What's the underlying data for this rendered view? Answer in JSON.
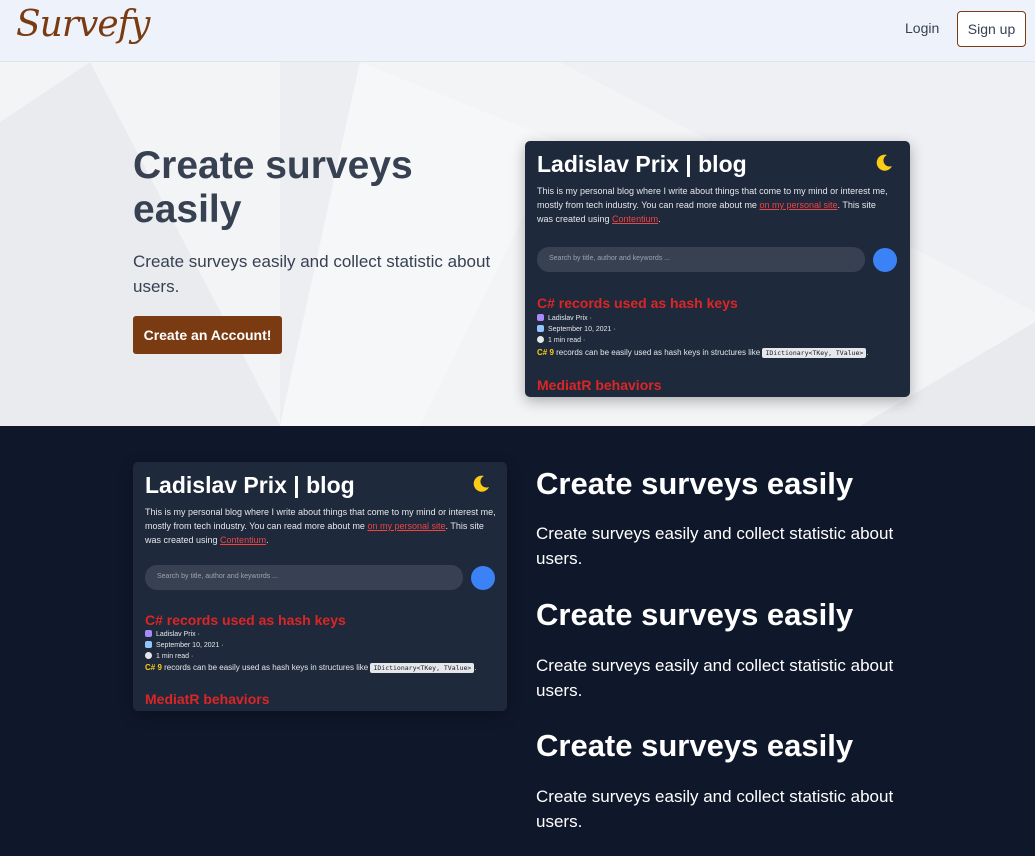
{
  "nav": {
    "logo": "Survefy",
    "login": "Login",
    "signup": "Sign up"
  },
  "hero": {
    "title": "Create surveys easily",
    "subtitle": "Create surveys easily and collect statistic about users.",
    "cta": "Create an Account!"
  },
  "blog_card": {
    "title": "Ladislav Prix | blog",
    "desc_before": "This is my personal blog where I write about things that come to my mind or interest me, mostly from tech industry. You can read more about me ",
    "desc_link": "on my personal site",
    "desc_mid": ". This site was created using ",
    "desc_link2": "Contentium",
    "desc_end": ".",
    "search_placeholder": "Search by title, author and keywords ...",
    "post1_title": "C# records used as hash keys",
    "post1_author": "Ladislav Prix ·",
    "post1_date": "September 10, 2021 ·",
    "post1_read": "1 min read ·",
    "post1_lang": "C# 9",
    "post1_text": " records can be easily used as hash keys in structures like ",
    "post1_code": "IDictionary<TKey, TValue>",
    "post1_end": ".",
    "post2_title": "MediatR behaviors"
  },
  "features": [
    {
      "title": "Create surveys easily",
      "text": "Create surveys easily and collect statistic about users."
    },
    {
      "title": "Create surveys easily",
      "text": "Create surveys easily and collect statistic about users."
    },
    {
      "title": "Create surveys easily",
      "text": "Create surveys easily and collect statistic about users."
    }
  ],
  "colors": {
    "brand": "#7a3a12",
    "accent_red": "#dc2626",
    "dark_bg": "#0f172a",
    "card_bg": "#1e293b"
  }
}
